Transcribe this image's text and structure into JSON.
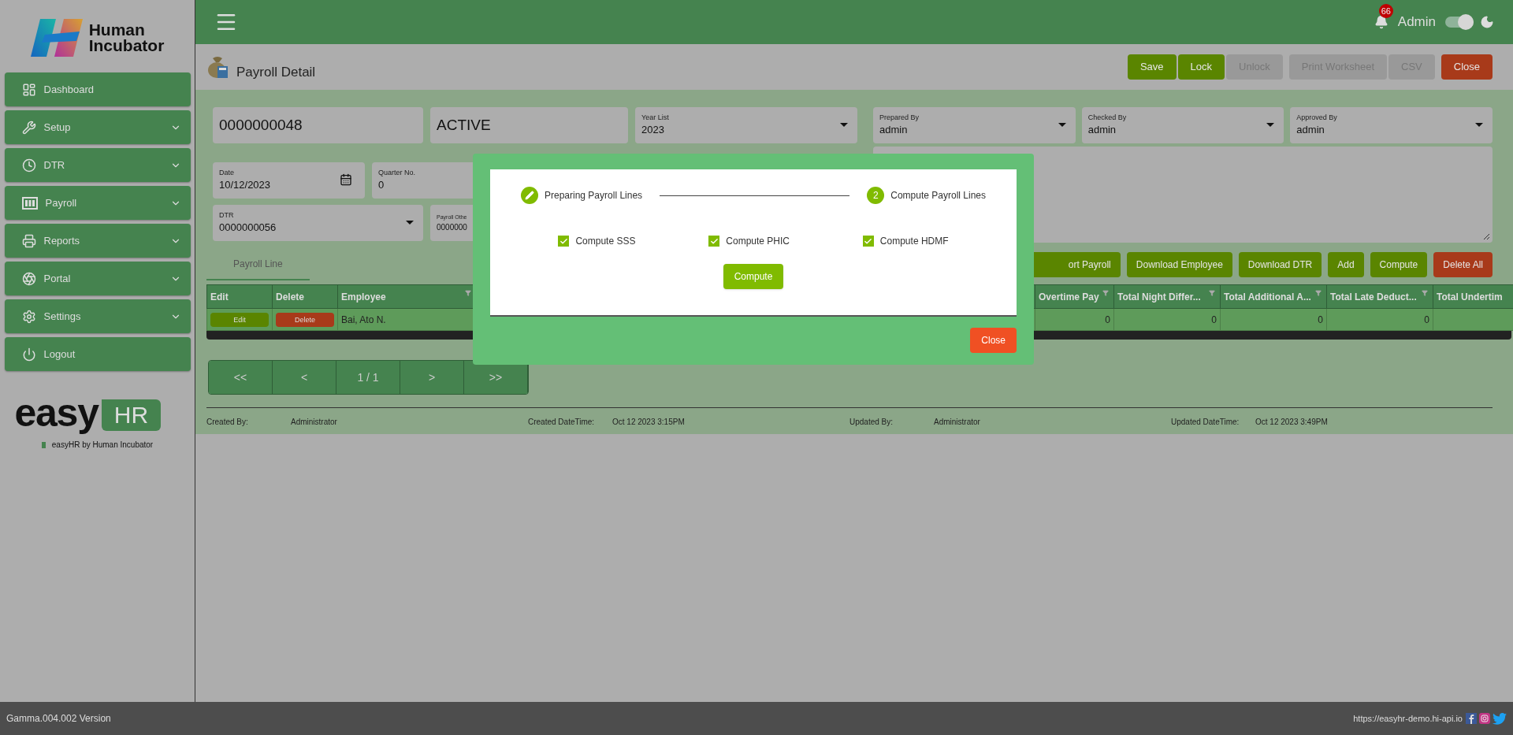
{
  "sidebar": {
    "brand_lines": [
      "Human",
      "Incubator"
    ],
    "items": [
      {
        "label": "Dashboard",
        "expandable": false
      },
      {
        "label": "Setup",
        "expandable": true
      },
      {
        "label": "DTR",
        "expandable": true
      },
      {
        "label": "Payroll",
        "expandable": true
      },
      {
        "label": "Reports",
        "expandable": true
      },
      {
        "label": "Portal",
        "expandable": true
      },
      {
        "label": "Settings",
        "expandable": true
      },
      {
        "label": "Logout",
        "expandable": false
      }
    ],
    "product": {
      "word": "easy",
      "badge": "HR",
      "tagline": "easyHR by Human Incubator"
    }
  },
  "header": {
    "notifications": "66",
    "user": "Admin",
    "theme_toggle_on": true
  },
  "page": {
    "title": "Payroll Detail",
    "actions": [
      {
        "label": "Save",
        "kind": "primary"
      },
      {
        "label": "Lock",
        "kind": "primary"
      },
      {
        "label": "Unlock",
        "kind": "disabled"
      },
      {
        "label": "Print Worksheet",
        "kind": "disabled"
      },
      {
        "label": "CSV",
        "kind": "disabled"
      },
      {
        "label": "Close",
        "kind": "danger"
      }
    ]
  },
  "form": {
    "left_rows": [
      [
        {
          "kind": "text",
          "value": "0000000048"
        },
        {
          "kind": "text",
          "value": "ACTIVE"
        },
        {
          "kind": "select",
          "label": "Year List",
          "value": "2023"
        }
      ],
      [
        {
          "kind": "date",
          "label": "Date",
          "value": "10/12/2023"
        },
        {
          "kind": "text",
          "label": "Quarter No.",
          "value": "0"
        }
      ],
      [
        {
          "kind": "select",
          "label": "DTR",
          "value": "0000000056"
        },
        {
          "kind": "text",
          "label": "Payroll Othe",
          "value": "0000000"
        }
      ]
    ],
    "right_fields": [
      {
        "kind": "select",
        "label": "Prepared By",
        "value": "admin"
      },
      {
        "kind": "select",
        "label": "Checked By",
        "value": "admin"
      },
      {
        "kind": "select",
        "label": "Approved By",
        "value": "admin"
      }
    ]
  },
  "tabs": [
    {
      "label": "Payroll Line",
      "selected": true
    }
  ],
  "line_actions": [
    {
      "label": "ort Payroll",
      "kind": "primary"
    },
    {
      "label": "Download Employee",
      "kind": "primary"
    },
    {
      "label": "Download DTR",
      "kind": "primary"
    },
    {
      "label": "Add",
      "kind": "primary"
    },
    {
      "label": "Compute",
      "kind": "primary"
    },
    {
      "label": "Delete All",
      "kind": "danger"
    }
  ],
  "table": {
    "left_columns": [
      "Edit",
      "Delete",
      "Employee"
    ],
    "right_columns": [
      "Overtime Pay",
      "Total Night Differ...",
      "Total Additional A...",
      "Total Late Deduct...",
      "Total Undertim"
    ],
    "rows": [
      {
        "edit": "Edit",
        "delete": "Delete",
        "employee": "Bai, Ato N.",
        "values": [
          "0",
          "0",
          "0",
          "0"
        ]
      }
    ]
  },
  "pagination": [
    "<<",
    "<",
    "1 / 1",
    ">",
    ">>"
  ],
  "audit": [
    {
      "label": "Created By:",
      "value": "Administrator"
    },
    {
      "label": "Created DateTime:",
      "value": "Oct 12 2023 3:15PM"
    },
    {
      "label": "Updated By:",
      "value": "Administrator"
    },
    {
      "label": "Updated DateTime:",
      "value": "Oct 12 2023 3:49PM"
    }
  ],
  "modal": {
    "steps": [
      {
        "label": "Preparing Payroll Lines",
        "done": true
      },
      {
        "number": "2",
        "label": "Compute Payroll Lines",
        "done": false
      }
    ],
    "options": [
      {
        "label": "Compute SSS",
        "checked": true
      },
      {
        "label": "Compute PHIC",
        "checked": true
      },
      {
        "label": "Compute HDMF",
        "checked": true
      }
    ],
    "compute": "Compute",
    "close": "Close"
  },
  "footer": {
    "version": "Gamma.004.002 Version",
    "url": "https://easyhr-demo.hi-api.io"
  }
}
